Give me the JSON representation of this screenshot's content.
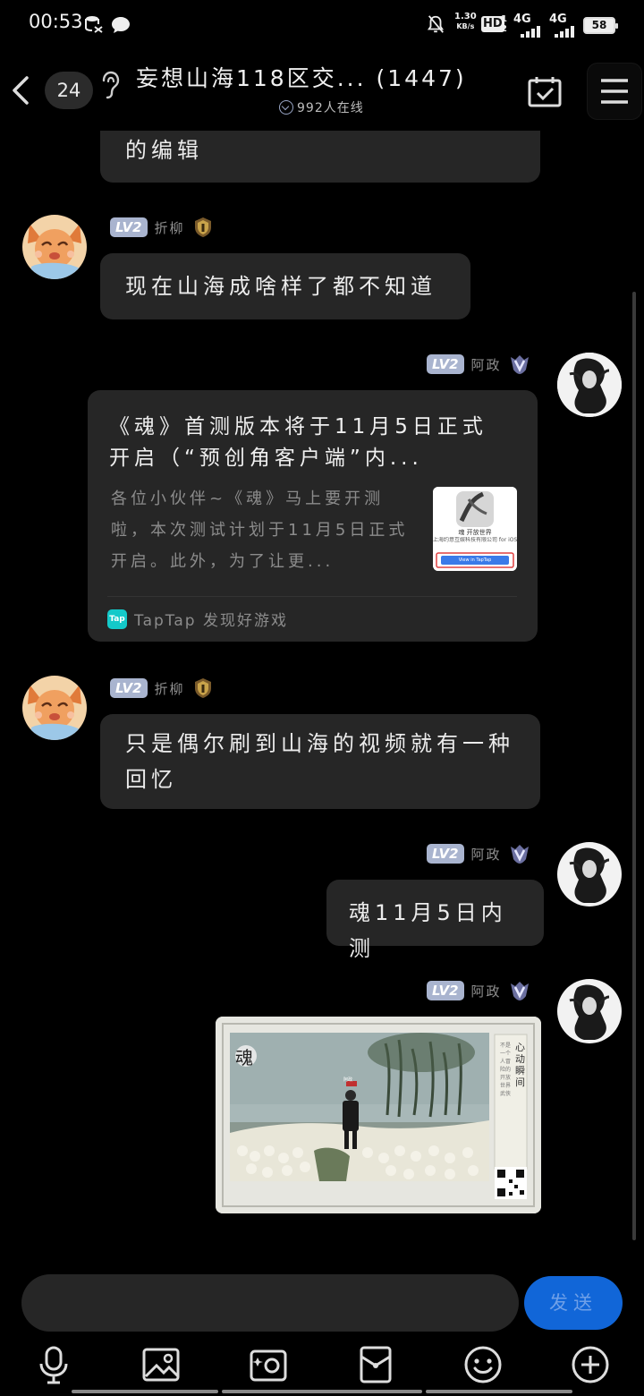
{
  "status": {
    "time": "00:53",
    "speed_value": "1.30",
    "speed_unit": "KB/s",
    "hd": "HD",
    "net1": "4G",
    "net2": "4G",
    "battery": "58"
  },
  "header": {
    "unread_badge": "24",
    "title": "妄想山海118区交... (1447)",
    "online_text": "992人在线"
  },
  "messages": [
    {
      "type": "text",
      "side": "left",
      "text": "的编辑"
    },
    {
      "type": "text",
      "side": "left",
      "level": "LV2",
      "nick": "折柳",
      "text": "现在山海成啥样了都不知道"
    },
    {
      "type": "card",
      "side": "right",
      "level": "LV2",
      "nick": "阿政",
      "card": {
        "title": "《魂》首测版本将于11月5日正式开启（“预创角客户端”内...",
        "desc": "各位小伙伴~《魂》马上要开测啦，本次测试计划于11月5日正式开启。此外，为了让更...",
        "thumb_line1": "魂 开放世界",
        "thumb_line2": "上海约意互娱科技有限公司 for iOS",
        "thumb_button": "View in TapTap",
        "source_logo": "Tap",
        "source": "TapTap 发现好游戏"
      }
    },
    {
      "type": "text",
      "side": "left",
      "level": "LV2",
      "nick": "折柳",
      "text": "只是偶尔刷到山海的视频就有一种回忆"
    },
    {
      "type": "text",
      "side": "right",
      "level": "LV2",
      "nick": "阿政",
      "text": "魂11月5日内测"
    },
    {
      "type": "image",
      "side": "right",
      "level": "LV2",
      "nick": "阿政",
      "image": {
        "logo": "魂",
        "side_title": "心动瞬间",
        "side_text": "不是一个人冒险的开放世界武侠",
        "tag": "阿政"
      }
    }
  ],
  "input": {
    "placeholder": "",
    "send_label": "发送"
  },
  "toolbar": {
    "icons": [
      "microphone-icon",
      "image-icon",
      "camera-icon",
      "red-packet-icon",
      "emoji-icon",
      "plus-icon"
    ]
  },
  "colors": {
    "background": "#000000",
    "bubble": "#262626",
    "level_badge": "#a9b4cf",
    "send_button": "#1166d8",
    "taptap": "#14c9c9"
  }
}
